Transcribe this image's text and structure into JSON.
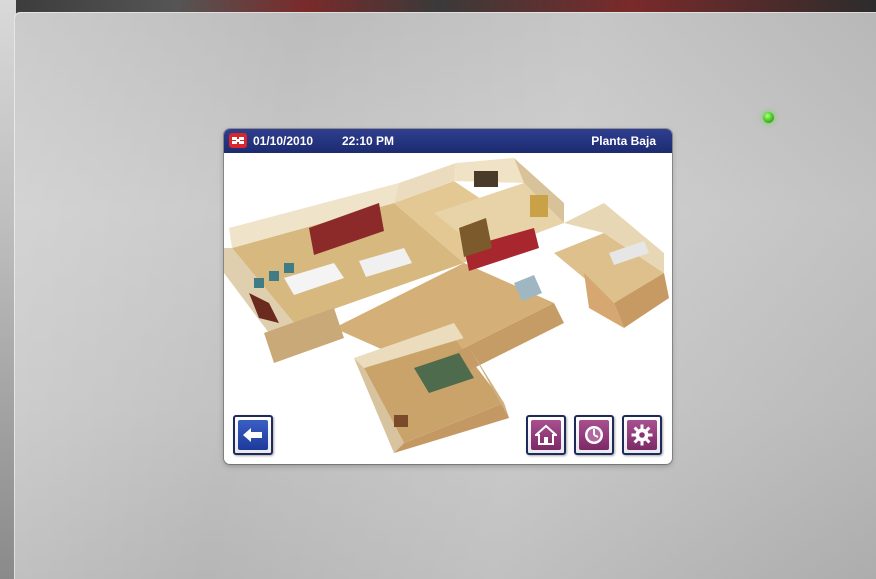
{
  "status_bar": {
    "date": "01/10/2010",
    "time": "22:10 PM",
    "floor": "Planta Baja"
  },
  "icons": {
    "logo": "brand-logo-icon",
    "back": "back-arrow-icon",
    "home": "home-icon",
    "clock": "clock-icon",
    "settings": "gear-icon",
    "status_led": "status-led-icon"
  },
  "colors": {
    "status_bar": "#1c2a6f",
    "back_button": "#1d3a9a",
    "action_buttons": "#7c2a67",
    "logo": "#d8262f",
    "led": "#4fd02a"
  }
}
